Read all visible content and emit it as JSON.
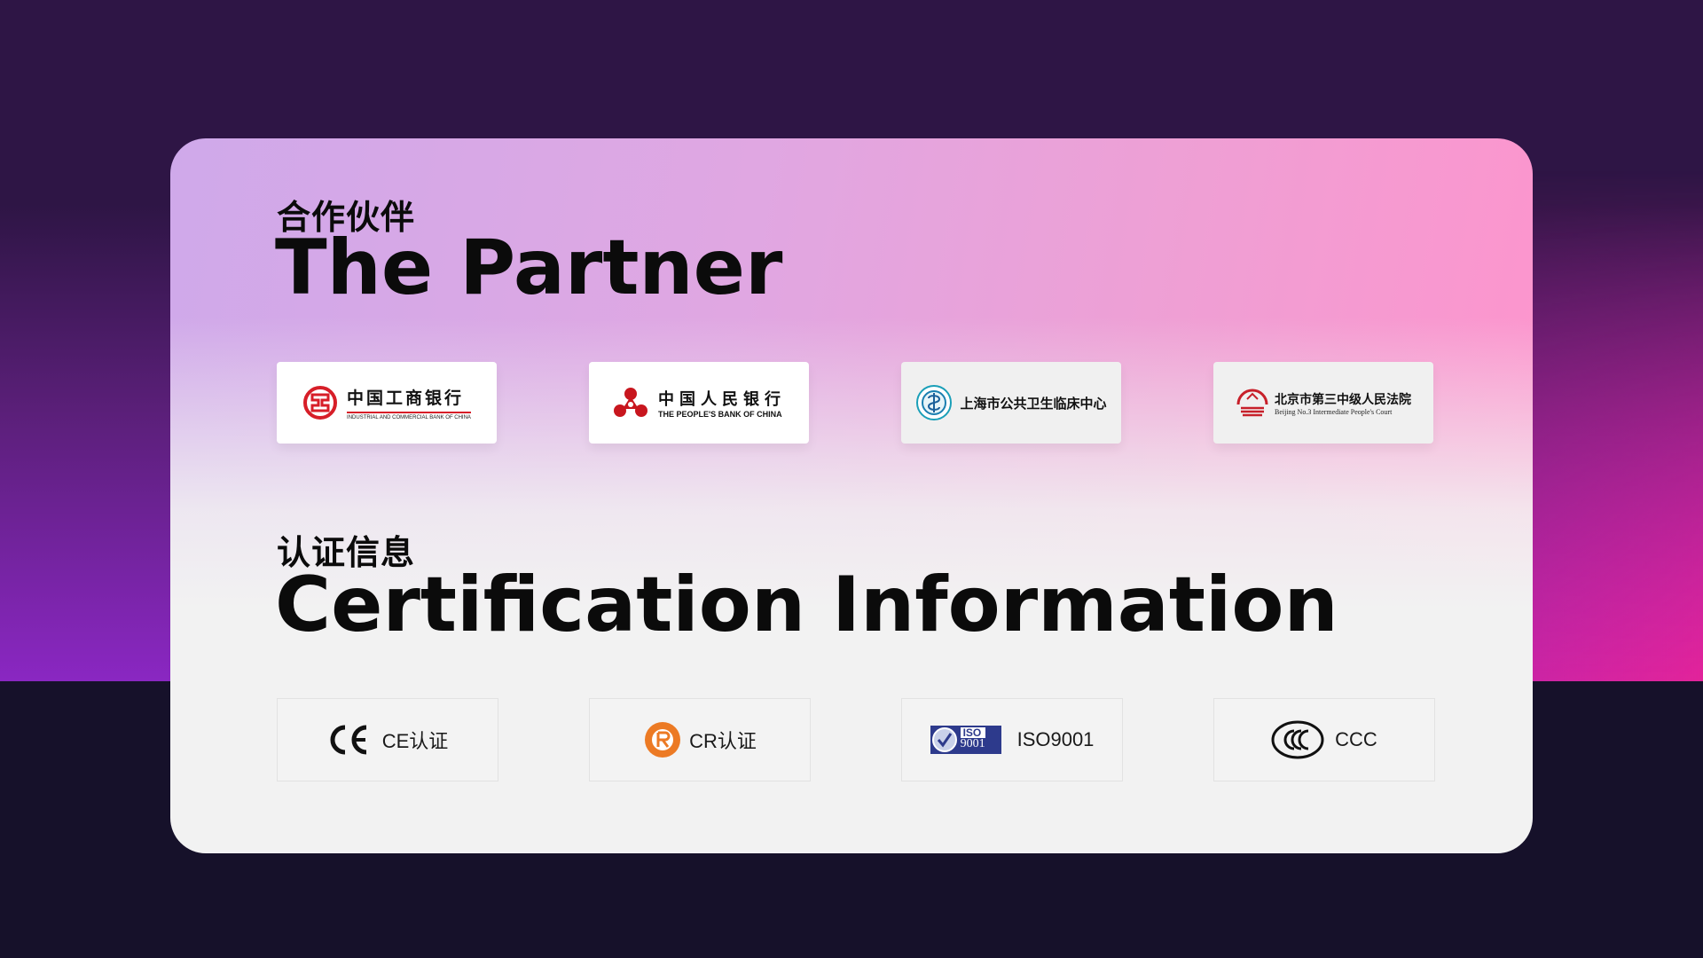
{
  "partner": {
    "title_cn": "合作伙伴",
    "title_en": "The Partner",
    "logos": [
      {
        "name_cn": "中国工商银行",
        "name_en": "INDUSTRIAL AND COMMERCIAL BANK OF CHINA",
        "icon": "icbc-logo-icon",
        "color": "#d71e28"
      },
      {
        "name_cn": "中国人民银行",
        "name_en": "THE PEOPLE'S BANK OF CHINA",
        "icon": "pboc-logo-icon",
        "color": "#c8161e"
      },
      {
        "name_cn": "上海市公共卫生临床中心",
        "icon": "shphc-logo-icon",
        "color": "#1a7fb0"
      },
      {
        "name_cn": "北京市第三中级人民法院",
        "name_en": "Beijing No.3 Intermediate People's Court",
        "icon": "court-logo-icon",
        "color": "#c7202a"
      }
    ]
  },
  "certification": {
    "title_cn": "认证信息",
    "title_en": "Certification Information",
    "items": [
      {
        "label": "CE认证",
        "icon": "ce-mark-icon"
      },
      {
        "label": "CR认证",
        "icon": "cr-mark-icon",
        "color": "#ec7a24"
      },
      {
        "label": "ISO9001",
        "icon": "iso9001-badge-icon",
        "badge_text": "ISO",
        "badge_sub": "9001",
        "color": "#2d3a8c"
      },
      {
        "label": "CCC",
        "icon": "ccc-mark-icon"
      }
    ]
  }
}
